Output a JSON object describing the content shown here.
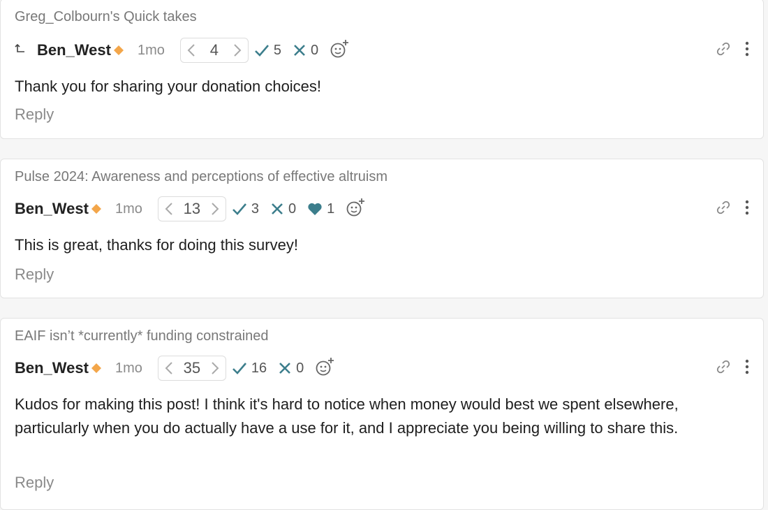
{
  "comments": [
    {
      "post_title": "Greg_Colbourn's Quick takes",
      "author": "Ben_West",
      "date": "1mo",
      "karma": "4",
      "agree": "5",
      "disagree": "0",
      "body": "Thank you for sharing your donation choices!",
      "reply_label": "Reply"
    },
    {
      "post_title": "Pulse 2024: Awareness and perceptions of effective altruism",
      "author": "Ben_West",
      "date": "1mo",
      "karma": "13",
      "agree": "3",
      "disagree": "0",
      "heart": "1",
      "body": "This is great, thanks for doing this survey!",
      "reply_label": "Reply"
    },
    {
      "post_title": "EAIF isn’t *currently* funding constrained",
      "author": "Ben_West",
      "date": "1mo",
      "karma": "35",
      "agree": "16",
      "disagree": "0",
      "body": "Kudos for making this post! I think it's hard to notice when money would best we spent elsewhere, particularly when you do actually have a use for it, and I appreciate you being willing to share this.",
      "reply_label": "Reply"
    }
  ],
  "icons": {
    "parent_comment": "return-arrow-icon",
    "author_badge": "diamond-icon",
    "vote_down": "chevron-left-icon",
    "vote_up": "chevron-right-icon",
    "agree": "check-icon",
    "disagree": "cross-icon",
    "heart": "heart-icon",
    "add_reaction": "add-reaction-icon",
    "link": "link-icon",
    "more": "more-vertical-icon"
  },
  "colors": {
    "react_teal": "#3c7e8c",
    "badge_orange": "#f3a64a"
  }
}
